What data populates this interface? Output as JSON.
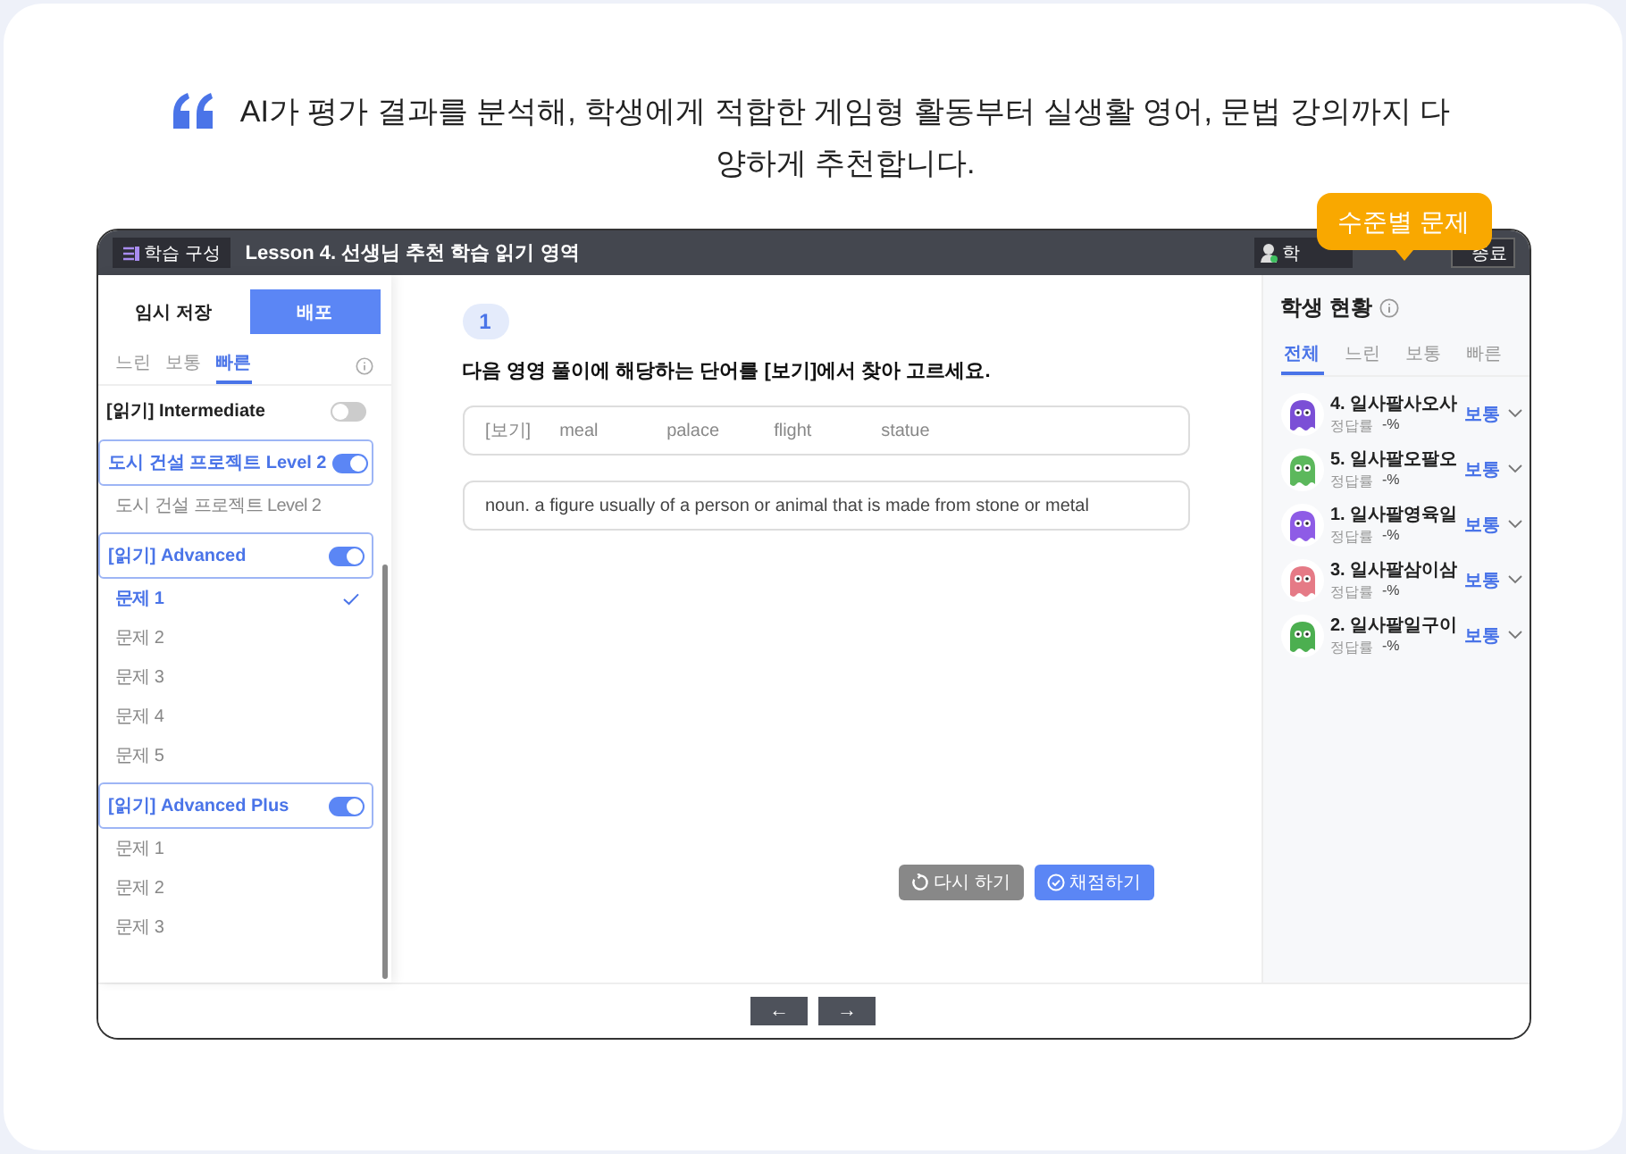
{
  "headline": "AI가 평가 결과를 분석해, 학생에게 적합한 게임형 활동부터 실생활 영어, 문법 강의까지 다양하게 추천합니다.",
  "callout": "수준별 문제",
  "window": {
    "menu_button": "학습 구성",
    "title": "Lesson 4. 선생님 추천 학습 읽기 영역",
    "header_buttons": [
      {
        "label": "학"
      },
      {
        "label": "종료"
      }
    ]
  },
  "sidebar": {
    "save_button": "임시 저장",
    "deploy_button": "배포",
    "tabs": [
      {
        "label": "느린",
        "selected": false
      },
      {
        "label": "보통",
        "selected": false
      },
      {
        "label": "빠른",
        "selected": true
      }
    ],
    "groups": [
      {
        "title": "[읽기] Intermediate",
        "on": false
      },
      {
        "title": "도시 건설 프로젝트 Level 2",
        "on": true,
        "items": [
          {
            "label": "도시 건설 프로젝트 Level 2",
            "selected": false
          }
        ]
      },
      {
        "title": "[읽기] Advanced",
        "on": true,
        "items": [
          {
            "label": "문제 1",
            "selected": true
          },
          {
            "label": "문제 2",
            "selected": false
          },
          {
            "label": "문제 3",
            "selected": false
          },
          {
            "label": "문제 4",
            "selected": false
          },
          {
            "label": "문제 5",
            "selected": false
          }
        ]
      },
      {
        "title": "[읽기] Advanced Plus",
        "on": true,
        "items": [
          {
            "label": "문제 1",
            "selected": false
          },
          {
            "label": "문제 2",
            "selected": false
          },
          {
            "label": "문제 3",
            "selected": false
          }
        ]
      }
    ]
  },
  "question": {
    "number": "1",
    "prompt": "다음 영영 풀이에 해당하는 단어를 [보기]에서 찾아 고르세요.",
    "choices_label": "[보기]",
    "choices": [
      "meal",
      "palace",
      "flight",
      "statue"
    ],
    "definition": "noun. a figure usually of a person or animal that is made from stone or metal",
    "retry_button": "다시 하기",
    "grade_button": "채점하기"
  },
  "footer": {
    "prev": "←",
    "next": "→"
  },
  "students_panel": {
    "title": "학생 현황",
    "tabs": [
      {
        "label": "전체",
        "selected": true
      },
      {
        "label": "느린",
        "selected": false
      },
      {
        "label": "보통",
        "selected": false
      },
      {
        "label": "빠른",
        "selected": false
      }
    ],
    "students": [
      {
        "name": "4. 일사팔사오사",
        "rate_label": "정답률",
        "rate": "-%",
        "level": "보통",
        "color": "#7b4fd6"
      },
      {
        "name": "5. 일사팔오팔오",
        "rate_label": "정답률",
        "rate": "-%",
        "level": "보통",
        "color": "#5cb85c"
      },
      {
        "name": "1. 일사팔영육일",
        "rate_label": "정답률",
        "rate": "-%",
        "level": "보통",
        "color": "#8e5ce6"
      },
      {
        "name": "3. 일사팔삼이삼",
        "rate_label": "정답률",
        "rate": "-%",
        "level": "보통",
        "color": "#e57a86"
      },
      {
        "name": "2. 일사팔일구이",
        "rate_label": "정답률",
        "rate": "-%",
        "level": "보통",
        "color": "#4caf50"
      }
    ]
  }
}
